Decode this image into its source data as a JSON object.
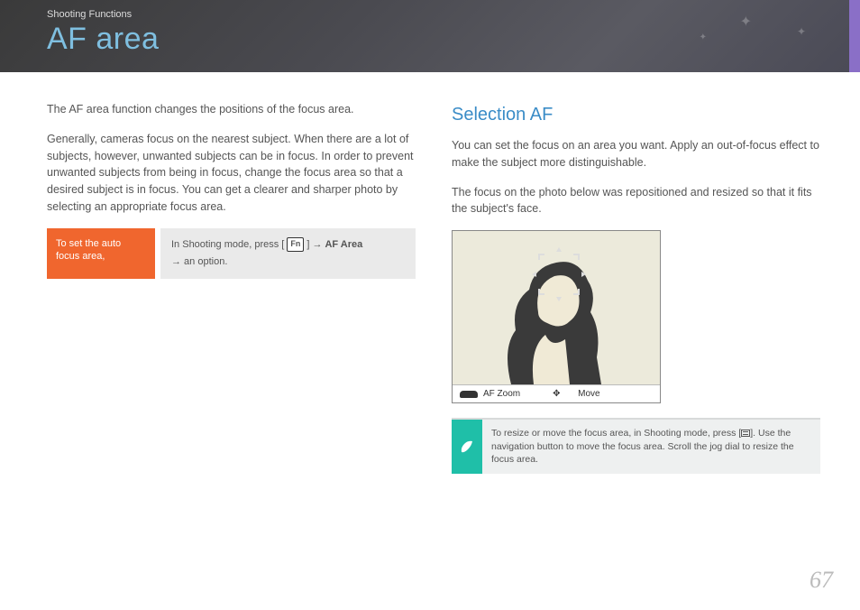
{
  "header": {
    "breadcrumb": "Shooting Functions",
    "title": "AF area"
  },
  "left": {
    "intro": "The AF area function changes the positions of the focus area.",
    "body": "Generally, cameras focus on the nearest subject. When there are a lot of subjects, however, unwanted subjects can be in focus. In order to prevent unwanted subjects from being in focus, change the focus area so that a desired subject is in focus. You can get a clearer and sharper photo by selecting an appropriate focus area.",
    "orange": "To set the auto focus area,",
    "grey_pre": "In Shooting mode, press [",
    "grey_fn": "Fn",
    "grey_mid": "] → ",
    "grey_bold": "AF Area",
    "grey_post": " → an option."
  },
  "right": {
    "section_title": "Selection AF",
    "p1": "You can set the focus on an area you want. Apply an out-of-focus effect to make the subject more distinguishable.",
    "p2": "The focus on the photo below was repositioned and resized so that it fits the subject's face.",
    "photo_bar": {
      "zoom": "AF Zoom",
      "move": "Move"
    },
    "note_pre": "To resize or move the focus area, in Shooting mode, press [",
    "note_post": "]. Use the navigation button to move the focus area. Scroll the jog dial to resize the focus area."
  },
  "page_number": "67"
}
